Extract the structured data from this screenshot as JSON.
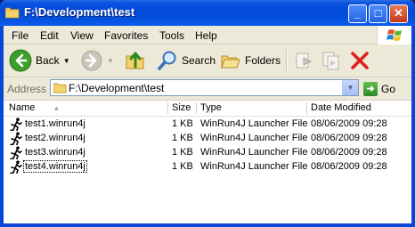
{
  "window": {
    "title": "F:\\Development\\test"
  },
  "title_buttons": {
    "minimize": "_",
    "maximize": "□",
    "close": "✕"
  },
  "menu": {
    "items": [
      {
        "label": "File"
      },
      {
        "label": "Edit"
      },
      {
        "label": "View"
      },
      {
        "label": "Favorites"
      },
      {
        "label": "Tools"
      },
      {
        "label": "Help"
      }
    ]
  },
  "toolbar": {
    "back_label": "Back",
    "search_label": "Search",
    "folders_label": "Folders"
  },
  "address": {
    "label": "Address",
    "value": "F:\\Development\\test",
    "go_label": "Go"
  },
  "list": {
    "columns": [
      "Name",
      "Size",
      "Type",
      "Date Modified"
    ],
    "rows": [
      {
        "name": "test1.winrun4j",
        "size": "1 KB",
        "type": "WinRun4J Launcher File",
        "date": "08/06/2009 09:28"
      },
      {
        "name": "test2.winrun4j",
        "size": "1 KB",
        "type": "WinRun4J Launcher File",
        "date": "08/06/2009 09:28"
      },
      {
        "name": "test3.winrun4j",
        "size": "1 KB",
        "type": "WinRun4J Launcher File",
        "date": "08/06/2009 09:28"
      },
      {
        "name": "test4.winrun4j",
        "size": "1 KB",
        "type": "WinRun4J Launcher File",
        "date": "08/06/2009 09:28"
      }
    ]
  },
  "icons": {
    "title": "folder-icon",
    "file": "running-man-icon",
    "back": "back-arrow-icon",
    "forward": "forward-arrow-icon",
    "up": "folder-up-icon",
    "search": "search-icon",
    "folders": "folders-icon",
    "move": "move-to-icon",
    "copy": "copy-to-icon",
    "delete": "delete-icon",
    "go": "go-arrow-icon"
  },
  "colors": {
    "titlebar": "#0a54e0",
    "chrome": "#ece9d8",
    "close_button": "#c6371a",
    "delete_red": "#e0201b",
    "back_green": "#3c9f2c"
  }
}
